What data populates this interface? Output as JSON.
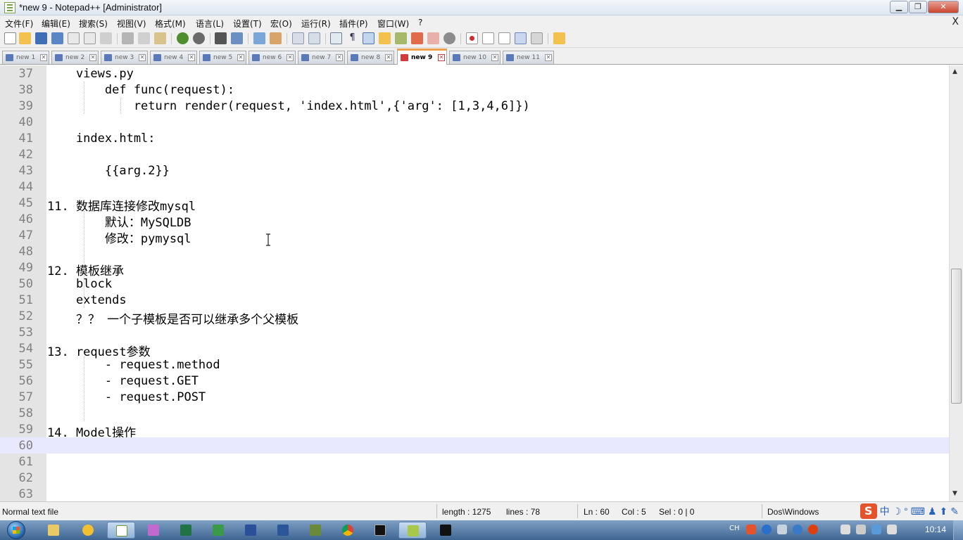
{
  "window": {
    "title": "*new 9 - Notepad++ [Administrator]",
    "minimize_glyph": "▁",
    "restore_glyph": "❐",
    "close_glyph": "✕"
  },
  "menu": {
    "items": [
      "文件(F)",
      "编辑(E)",
      "搜索(S)",
      "视图(V)",
      "格式(M)",
      "语言(L)",
      "设置(T)",
      "宏(O)",
      "运行(R)",
      "插件(P)",
      "窗口(W)",
      "?"
    ],
    "close_doc": "X"
  },
  "tabs": [
    {
      "label": "new 1",
      "active": false
    },
    {
      "label": "new 2",
      "active": false
    },
    {
      "label": "new 3",
      "active": false
    },
    {
      "label": "new 4",
      "active": false
    },
    {
      "label": "new 5",
      "active": false
    },
    {
      "label": "new 6",
      "active": false
    },
    {
      "label": "new 7",
      "active": false
    },
    {
      "label": "new 8",
      "active": false
    },
    {
      "label": "new 9",
      "active": true
    },
    {
      "label": "new 10",
      "active": false
    },
    {
      "label": "new 11",
      "active": false
    }
  ],
  "editor": {
    "current_line": 60,
    "lines": [
      {
        "n": "37",
        "text": "    views.py"
      },
      {
        "n": "38",
        "text": "        def func(request):"
      },
      {
        "n": "39",
        "text": "            return render(request, 'index.html',{'arg': [1,3,4,6]})"
      },
      {
        "n": "40",
        "text": ""
      },
      {
        "n": "41",
        "text": "    index.html:"
      },
      {
        "n": "42",
        "text": ""
      },
      {
        "n": "43",
        "text": "        {{arg.2}}"
      },
      {
        "n": "44",
        "text": ""
      },
      {
        "n": "45",
        "text": "11. 数据库连接修改mysql"
      },
      {
        "n": "46",
        "text": "        默认：MySQLDB"
      },
      {
        "n": "47",
        "text": "        修改：pymysql"
      },
      {
        "n": "48",
        "text": ""
      },
      {
        "n": "49",
        "text": "12. 模板继承"
      },
      {
        "n": "50",
        "text": "    block"
      },
      {
        "n": "51",
        "text": "    extends"
      },
      {
        "n": "52",
        "text": "    ？？ 一个子模板是否可以继承多个父模板"
      },
      {
        "n": "53",
        "text": ""
      },
      {
        "n": "54",
        "text": "13. request参数"
      },
      {
        "n": "55",
        "text": "        - request.method"
      },
      {
        "n": "56",
        "text": "        - request.GET"
      },
      {
        "n": "57",
        "text": "        - request.POST"
      },
      {
        "n": "58",
        "text": ""
      },
      {
        "n": "59",
        "text": "14. Model操作"
      },
      {
        "n": "60",
        "text": ""
      },
      {
        "n": "61",
        "text": ""
      },
      {
        "n": "62",
        "text": ""
      },
      {
        "n": "63",
        "text": ""
      }
    ]
  },
  "statusbar": {
    "file_type": "Normal text file",
    "length": "length : 1275",
    "lines": "lines : 78",
    "ln": "Ln : 60",
    "col": "Col : 5",
    "sel": "Sel : 0 | 0",
    "eol": "Dos\\Windows",
    "ime_logo": "S",
    "ime_mode": "中"
  },
  "taskbar": {
    "lang": "CH",
    "time": "10:14"
  },
  "colors": {
    "accent_tab": "#f0a04a",
    "current_line": "#e8e8ff",
    "line_number": "#808080"
  }
}
